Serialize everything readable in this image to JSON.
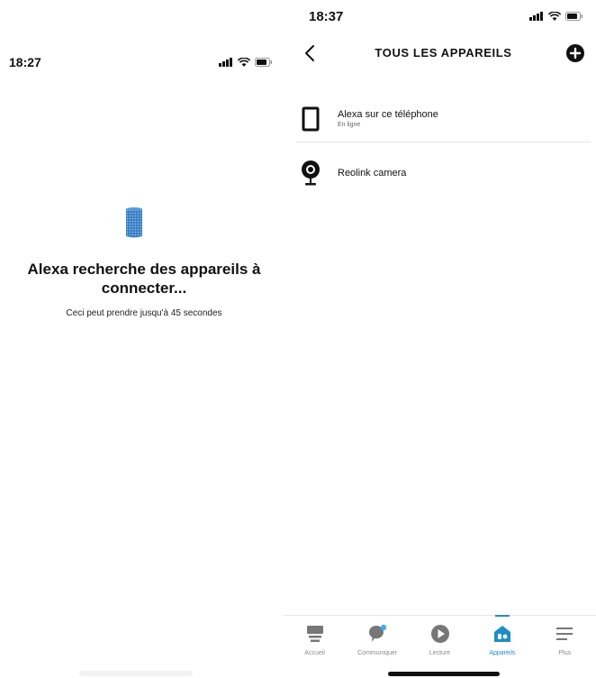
{
  "left_screen": {
    "status": {
      "time": "18:27"
    },
    "search": {
      "title_line1": "Alexa recherche des appareils à",
      "title_line2": "connecter...",
      "subtitle": "Ceci peut prendre jusqu'à 45 secondes"
    }
  },
  "right_screen": {
    "status": {
      "time": "18:37"
    },
    "header": {
      "title": "TOUS LES APPAREILS",
      "back_icon": "chevron-left-icon",
      "add_icon": "plus-circle-icon"
    },
    "devices": [
      {
        "name": "Alexa sur ce téléphone",
        "status": "En ligne",
        "icon": "phone-icon"
      },
      {
        "name": "Reolink camera",
        "status": "",
        "icon": "camera-icon"
      }
    ],
    "tabs": [
      {
        "label": "Accueil",
        "icon": "home-icon"
      },
      {
        "label": "Communiquer",
        "icon": "chat-icon"
      },
      {
        "label": "Lecture",
        "icon": "play-icon"
      },
      {
        "label": "Appareils",
        "icon": "devices-icon",
        "active": true
      },
      {
        "label": "Plus",
        "icon": "menu-icon"
      }
    ]
  },
  "colors": {
    "accent": "#1d8ec8",
    "notification_dot": "#3bb0f0",
    "text": "#111111",
    "muted": "#8a8a8a"
  }
}
